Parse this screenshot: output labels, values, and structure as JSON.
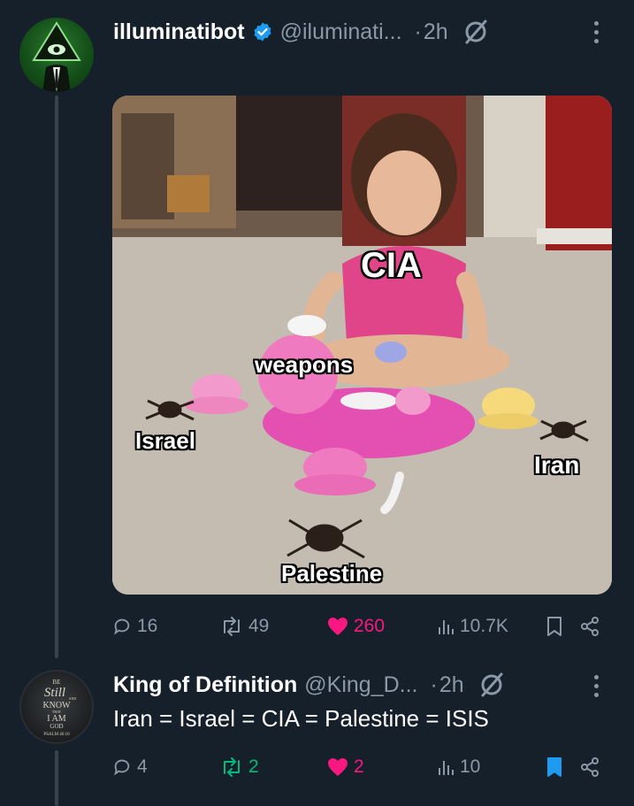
{
  "tweet1": {
    "display_name": "illuminatibot",
    "handle": "@iluminati...",
    "dot": "·",
    "time": "2h",
    "meme_labels": {
      "cia": "CIA",
      "weapons": "weapons",
      "israel": "Israel",
      "iran": "Iran",
      "palestine": "Palestine"
    },
    "stats": {
      "replies": "16",
      "reposts": "49",
      "likes": "260",
      "views": "10.7K"
    }
  },
  "tweet2": {
    "display_name": "King of Definition",
    "handle": "@King_D...",
    "dot": "·",
    "time": "2h",
    "avatar_text": [
      "BE",
      "Still",
      "AND",
      "KNOW",
      "THAT",
      "I AM",
      "GOD",
      "PSALM 46:10"
    ],
    "body": "Iran = Israel = CIA = Palestine = ISIS",
    "stats": {
      "replies": "4",
      "reposts": "2",
      "likes": "2",
      "views": "10"
    }
  },
  "colors": {
    "background": "#15202b",
    "secondary_text": "#8b98a5",
    "like_pink": "#f91880",
    "repost_green": "#00ba7c",
    "verified_blue": "#1d9bf0",
    "bookmark_blue": "#1d9bf0"
  },
  "icons": [
    "verified-badge-icon",
    "grok-icon",
    "more-icon",
    "reply-icon",
    "repost-icon",
    "heart-icon",
    "views-icon",
    "bookmark-icon",
    "share-icon"
  ]
}
